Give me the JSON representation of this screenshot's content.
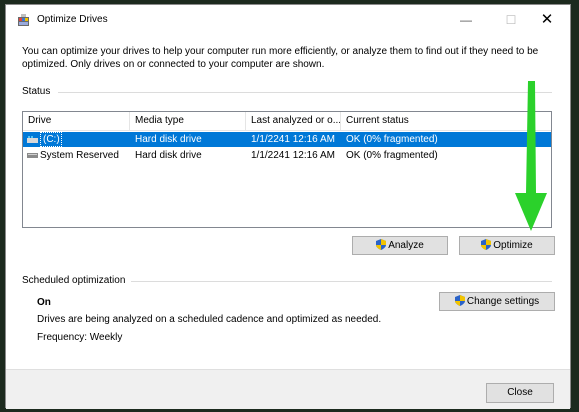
{
  "window": {
    "title": "Optimize Drives",
    "minimize_glyph": "—",
    "maximize_glyph": "☐",
    "close_glyph": "✕"
  },
  "description": "You can optimize your drives to help your computer run more efficiently, or analyze them to find out if they need to be optimized. Only drives on or connected to your computer are shown.",
  "status": {
    "label": "Status",
    "columns": [
      "Drive",
      "Media type",
      "Last analyzed or o...",
      "Current status"
    ],
    "rows": [
      {
        "drive": "(C:)",
        "media": "Hard disk drive",
        "last": "1/1/2241 12:16 AM",
        "status": "OK (0% fragmented)",
        "icon": "windows-drive-icon",
        "selected": true
      },
      {
        "drive": "System Reserved",
        "media": "Hard disk drive",
        "last": "1/1/2241 12:16 AM",
        "status": "OK (0% fragmented)",
        "icon": "drive-icon",
        "selected": false
      }
    ],
    "analyze_label": "Analyze",
    "optimize_label": "Optimize"
  },
  "scheduled": {
    "label": "Scheduled optimization",
    "state": "On",
    "description": "Drives are being analyzed on a scheduled cadence and optimized as needed.",
    "frequency": "Frequency: Weekly",
    "change_label": "Change settings"
  },
  "footer": {
    "close_label": "Close"
  },
  "colors": {
    "selection": "#0078d7",
    "annotation_arrow": "#2bd12b",
    "shield_blue": "#2a63c9",
    "shield_yellow": "#f2c400"
  }
}
